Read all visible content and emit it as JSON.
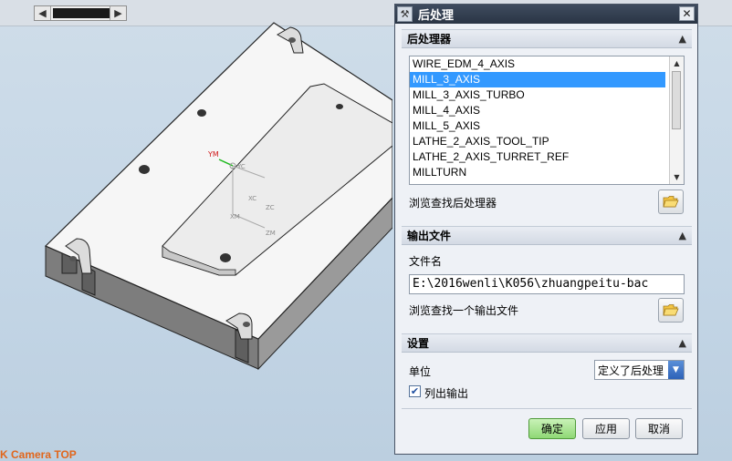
{
  "viewport": {
    "camera_label": "K Camera TOP",
    "axis_labels": {
      "ym": "YM",
      "yc": "YC",
      "xc": "XC",
      "zc": "ZC",
      "xm": "XM",
      "zm": "ZM"
    }
  },
  "dialog": {
    "title": "后处理",
    "postprocessor_section": {
      "title": "后处理器",
      "items": [
        "WIRE_EDM_4_AXIS",
        "MILL_3_AXIS",
        "MILL_3_AXIS_TURBO",
        "MILL_4_AXIS",
        "MILL_5_AXIS",
        "LATHE_2_AXIS_TOOL_TIP",
        "LATHE_2_AXIS_TURRET_REF",
        "MILLTURN"
      ],
      "selected_index": 1,
      "browse_label": "浏览查找后处理器"
    },
    "output_section": {
      "title": "输出文件",
      "filename_label": "文件名",
      "filename_value": "E:\\2016wenli\\K056\\zhuangpeitu-bac",
      "browse_label": "浏览查找一个输出文件"
    },
    "settings_section": {
      "title": "设置",
      "unit_label": "单位",
      "unit_value": "定义了后处理",
      "list_output_label": "列出输出",
      "list_output_checked": true
    },
    "buttons": {
      "ok": "确定",
      "apply": "应用",
      "cancel": "取消"
    }
  }
}
